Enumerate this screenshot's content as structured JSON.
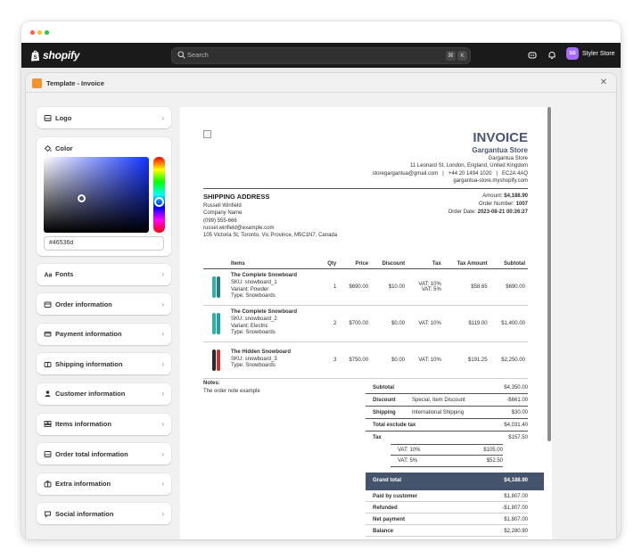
{
  "colors": {
    "accent": "#46536d",
    "topbar": "#1a1a1a",
    "avatar": "#a36bff",
    "app_icon": "#f4932a"
  },
  "topbar": {
    "brand": "shopify",
    "search_placeholder": "Search",
    "shortcut_keys": [
      "⌘",
      "K"
    ],
    "store_initials": "SS",
    "store_name": "Styler Store"
  },
  "modal": {
    "title": "Template - Invoice"
  },
  "sidebar": {
    "logo_label": "Logo",
    "color_label": "Color",
    "color_value": "#46536d",
    "sections": [
      {
        "label": "Fonts",
        "icon": "fonts-icon"
      },
      {
        "label": "Order information",
        "icon": "order-icon"
      },
      {
        "label": "Payment information",
        "icon": "payment-icon"
      },
      {
        "label": "Shipping information",
        "icon": "shipping-icon"
      },
      {
        "label": "Customer information",
        "icon": "customer-icon"
      },
      {
        "label": "Items information",
        "icon": "items-icon"
      },
      {
        "label": "Order total information",
        "icon": "order-total-icon"
      },
      {
        "label": "Extra information",
        "icon": "extra-icon"
      },
      {
        "label": "Social information",
        "icon": "social-icon"
      }
    ]
  },
  "invoice": {
    "title": "INVOICE",
    "store_name": "Gargantua Store",
    "store_lines": [
      "Gargantua Store",
      "11 Leonard St, London, England, United Kingdom",
      "storegargantua@gmail.com   |   +44 20 1494 1020   |   EC2A 4AQ",
      "gargantua-store.myshopify.com"
    ],
    "shipping_title": "SHIPPING ADDRESS",
    "shipping_lines": [
      "Russell Winfield",
      "Company Name",
      "(099) 555-666",
      "russel.winfield@example.com",
      "105 Victoria St, Toronto, Vic Province, M5C1N7, Canada"
    ],
    "amount_label": "Amount:",
    "amount_value": "$4,188.90",
    "order_number_label": "Order Number:",
    "order_number_value": "1007",
    "order_date_label": "Order Date:",
    "order_date_value": "2023-08-21 00:26:27",
    "headers": [
      "Items",
      "Qty",
      "Price",
      "Discount",
      "Tax",
      "Tax Amount",
      "Subtotal"
    ],
    "items": [
      {
        "name": "The Complete Snowboard",
        "sku": "SKU: snowboard_1",
        "variant": "Variant: Powder",
        "type": "Type: Snowboards",
        "qty": "1",
        "price": "$690.00",
        "discount": "$10.00",
        "tax": "VAT: 10%",
        "tax2": "VAT: 5%",
        "tax_amount": "$58.65",
        "subtotal": "$690.00"
      },
      {
        "name": "The Complete Snowboard",
        "sku": "SKU: snowboard_2",
        "variant": "Variant: Electric",
        "type": "Type: Snowboards",
        "qty": "2",
        "price": "$700.00",
        "discount": "$0.00",
        "tax": "VAT: 10%",
        "tax2": "",
        "tax_amount": "$119.00",
        "subtotal": "$1,400.00"
      },
      {
        "name": "The Hidden Snowboard",
        "sku": "SKU: snowboard_3",
        "variant": "",
        "type": "Type: Snowboards",
        "qty": "3",
        "price": "$750.00",
        "discount": "$0.00",
        "tax": "VAT: 10%",
        "tax2": "",
        "tax_amount": "$191.25",
        "subtotal": "$2,250.00"
      }
    ],
    "notes_label": "Notes:",
    "notes_text": "The order note example",
    "totals": {
      "subtotal_label": "Subtotal",
      "subtotal": "$4,350.00",
      "discount_label": "Discount",
      "discount_desc": "Special, Item Discount",
      "discount": "-$661.00",
      "shipping_label": "Shipping",
      "shipping_desc": "International Shipping",
      "shipping": "$30.00",
      "exclude_label": "Total exclude tax",
      "exclude": "$4,031.40",
      "tax_label": "Tax",
      "tax": "$157.50",
      "vat10_label": "VAT: 10%",
      "vat10": "$105.00",
      "vat5_label": "VAT: 5%",
      "vat5": "$52.50",
      "grand_label": "Grand total",
      "grand": "$4,188.90",
      "paid_label": "Paid by customer",
      "paid": "$1,807.00",
      "refunded_label": "Refunded",
      "refunded": "-$1,807.00",
      "net_label": "Net payment",
      "net": "$1,807.00",
      "balance_label": "Balance",
      "balance": "$2,280.90"
    }
  }
}
